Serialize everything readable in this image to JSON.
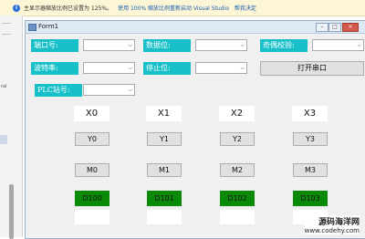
{
  "notification": {
    "message": "主显示器缩放比例已设置为 125%。",
    "action_restart": "使用 100% 缩放比例重新启动 Visual Studio",
    "action_help": "帮我决定"
  },
  "left_panel": {
    "fragment": "ral"
  },
  "window": {
    "title": "Form1",
    "minimize": "–",
    "maximize": "□",
    "close": "×"
  },
  "labels": {
    "port": "端口号:",
    "data_bits": "数据位:",
    "parity": "奇偶校验:",
    "baud": "波特率:",
    "stop_bits": "停止位:",
    "plc_station": "PLC站号:"
  },
  "combos": {
    "arrow": "⌵"
  },
  "open_port_button": "打开串口",
  "x_labels": [
    "X0",
    "X1",
    "X2",
    "X3"
  ],
  "y_buttons": [
    "Y0",
    "Y1",
    "Y2",
    "Y3"
  ],
  "m_buttons": [
    "M0",
    "M1",
    "M2",
    "M3"
  ],
  "d_labels": [
    "D100",
    "D101",
    "D102",
    "D103"
  ],
  "colors": {
    "label_bg": "#17c0c8",
    "d_bg": "#0b8a08"
  },
  "watermark": {
    "line1": "源码海洋网",
    "line2": "www.codehy.com"
  }
}
